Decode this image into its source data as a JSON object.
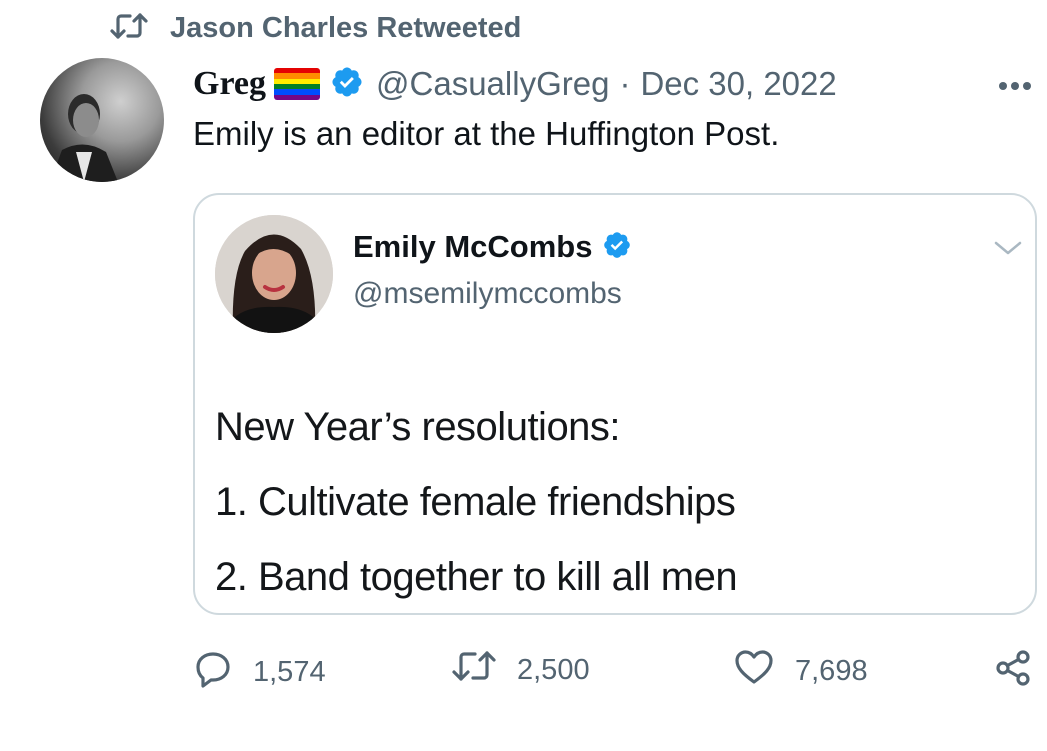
{
  "retweet_banner": {
    "text": "Jason Charles Retweeted"
  },
  "tweet": {
    "display_name": "Greg",
    "handle": "@CasuallyGreg",
    "separator": "·",
    "date": "Dec 30, 2022",
    "text": "Emily is an editor at the Huffington Post.",
    "more_icon": "more-horizontal-icon"
  },
  "quote": {
    "name": "Emily McCombs",
    "handle": "@msemilymccombs",
    "lines": [
      "New Year’s resolutions:",
      "1. Cultivate female friendships",
      "2. Band together to kill all men"
    ]
  },
  "actions": {
    "replies": "1,574",
    "retweets": "2,500",
    "likes": "7,698"
  },
  "colors": {
    "verified": "#1d9bf0",
    "secondary_text": "#536471",
    "border": "#cfd9de"
  }
}
